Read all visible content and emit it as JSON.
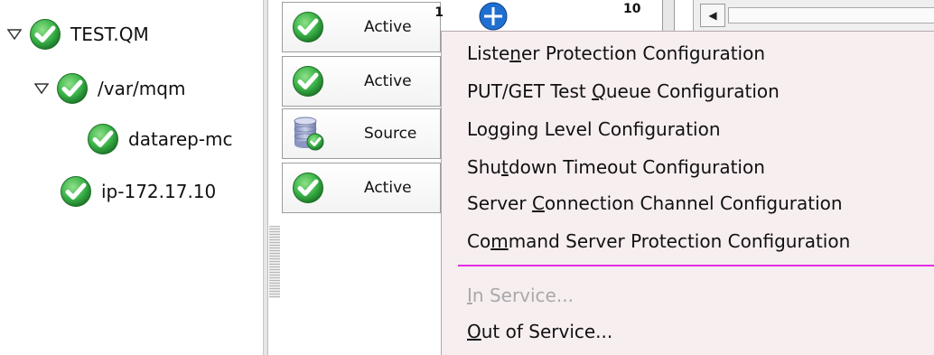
{
  "tree": {
    "nodes": [
      {
        "label": "TEST.QM",
        "expanded": true
      },
      {
        "label": "/var/mqm",
        "expanded": true
      },
      {
        "label": "datarep-mc"
      },
      {
        "label": "ip-172.17.10"
      }
    ]
  },
  "status_cells": [
    {
      "icon": "check-icon",
      "label": "Active",
      "number": "1"
    },
    {
      "icon": "check-icon",
      "label": "Active"
    },
    {
      "icon": "database-check-icon",
      "label": "Source"
    },
    {
      "icon": "check-icon",
      "label": "Active"
    }
  ],
  "top_right": {
    "number": "10"
  },
  "context_menu": {
    "items": [
      {
        "pre": "Liste",
        "mn": "n",
        "post": "er Protection Configuration"
      },
      {
        "pre": "PUT/GET Test ",
        "mn": "Q",
        "post": "ueue Configuration"
      },
      {
        "pre": "Lo",
        "mn": "g",
        "post": "ging Level Configuration"
      },
      {
        "pre": "Shu",
        "mn": "t",
        "post": "down Timeout Configuration"
      },
      {
        "pre": "Server ",
        "mn": "C",
        "post": "onnection Channel Configuration"
      },
      {
        "pre": "Co",
        "mn": "m",
        "post": "mand Server Protection Configuration"
      }
    ],
    "secondary": [
      {
        "pre": "",
        "mn": "I",
        "post": "n Service...",
        "disabled": true
      },
      {
        "pre": "",
        "mn": "O",
        "post": "ut of Service..."
      }
    ]
  },
  "colors": {
    "check_green": "#3db54a",
    "menu_bg": "#f7eef0",
    "separator": "#e22ee2",
    "info_blue": "#1f6fd1"
  }
}
